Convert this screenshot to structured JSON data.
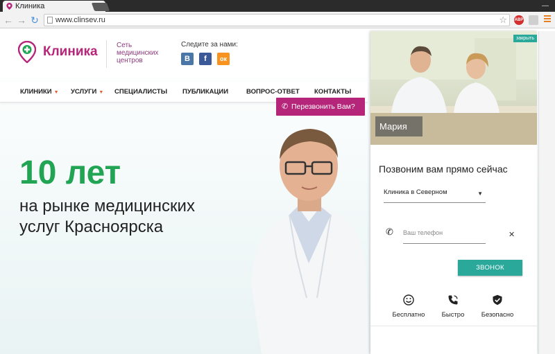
{
  "browser": {
    "tab_title": "Клиника",
    "url": "www.clinsev.ru",
    "ext_abp": "ABP"
  },
  "header": {
    "logo": "Клиника",
    "logo_subtitle_1": "Сеть",
    "logo_subtitle_2": "медицинских",
    "logo_subtitle_3": "центров",
    "social_title": "Следите за нами:",
    "social": [
      {
        "label": "В",
        "color": "#4a76a8"
      },
      {
        "label": "f",
        "color": "#3b5998"
      },
      {
        "label": "ок",
        "color": "#f7931e"
      }
    ]
  },
  "nav": {
    "items": [
      "КЛИНИКИ",
      "УСЛУГИ",
      "СПЕЦИАЛИСТЫ",
      "ПУБЛИКАЦИИ",
      "ВОПРОС-ОТВЕТ",
      "КОНТАКТЫ"
    ]
  },
  "callback_button": "Перезвонить Вам?",
  "hero": {
    "big": "10 лет",
    "line1": "на рынке медицинских",
    "line2": "услуг Красноярска"
  },
  "widget": {
    "close": "закрыть",
    "name": "Мария",
    "title": "Позвоним вам прямо сейчас",
    "clinic_select": "Клиника в Северном",
    "phone_placeholder": "Ваш телефон",
    "call_button": "ЗВОНОК",
    "features": [
      "Бесплатно",
      "Быстро",
      "Безопасно"
    ]
  },
  "colors": {
    "brand": "#b5267a",
    "accent": "#2aa89a",
    "hero_green": "#21a453"
  }
}
